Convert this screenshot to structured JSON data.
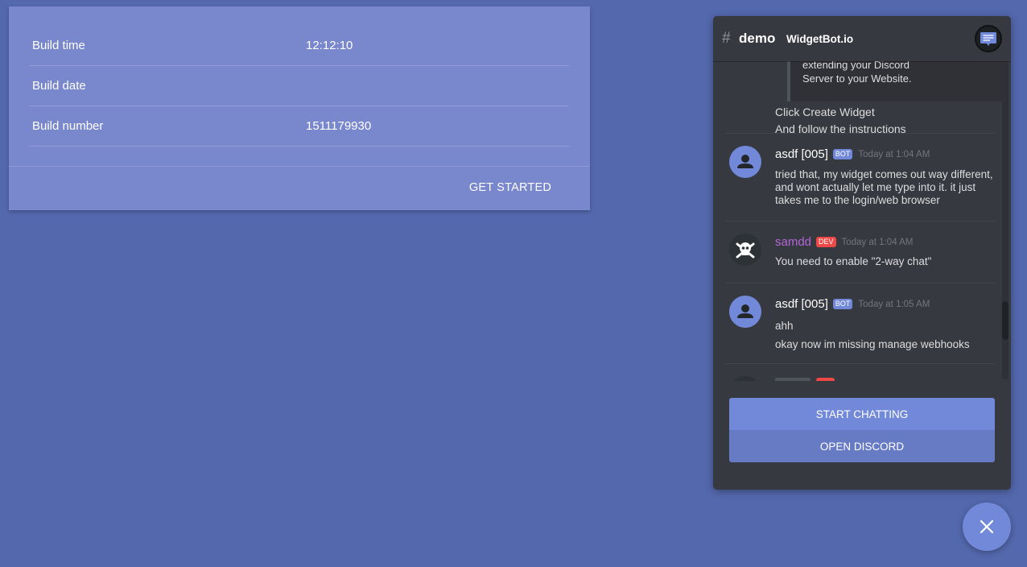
{
  "build_card": {
    "rows": [
      {
        "label": "Build time",
        "value": "12:12:10"
      },
      {
        "label": "Build date",
        "value": ""
      },
      {
        "label": "Build number",
        "value": "1511179930"
      }
    ],
    "action_label": "GET STARTED"
  },
  "widget": {
    "header": {
      "hash": "#",
      "channel": "demo",
      "server": "WidgetBot.io",
      "icon": "chat-bubble-icon"
    },
    "messages": [
      {
        "embed_lines": [
          "extending your Discord",
          "Server to your Website."
        ],
        "lines": [
          "Click Create Widget",
          "And follow the instructions"
        ]
      },
      {
        "author": "asdf [005]",
        "tag": "BOT",
        "timestamp": "Today at 1:04 AM",
        "text": "tried that, my widget comes out way different, and wont actually let me type into it. it just takes me to the login/web browser"
      },
      {
        "author": "samdd",
        "tag": "DEV",
        "timestamp": "Today at 1:04 AM",
        "text": "You need to enable \"2-way chat\""
      },
      {
        "author": "asdf [005]",
        "tag": "BOT",
        "timestamp": "Today at 1:05 AM",
        "lines": [
          "ahh",
          "okay now im missing manage webhooks"
        ]
      }
    ],
    "start_chatting_label": "START CHATTING",
    "open_discord_label": "OPEN DISCORD"
  },
  "close_button_icon": "close-icon",
  "colors": {
    "background": "#5468ad",
    "card": "#7987cd",
    "widget": "#36393f",
    "accent": "#7289da",
    "dev_tag": "#f04747",
    "dev_name": "#b565d8"
  }
}
